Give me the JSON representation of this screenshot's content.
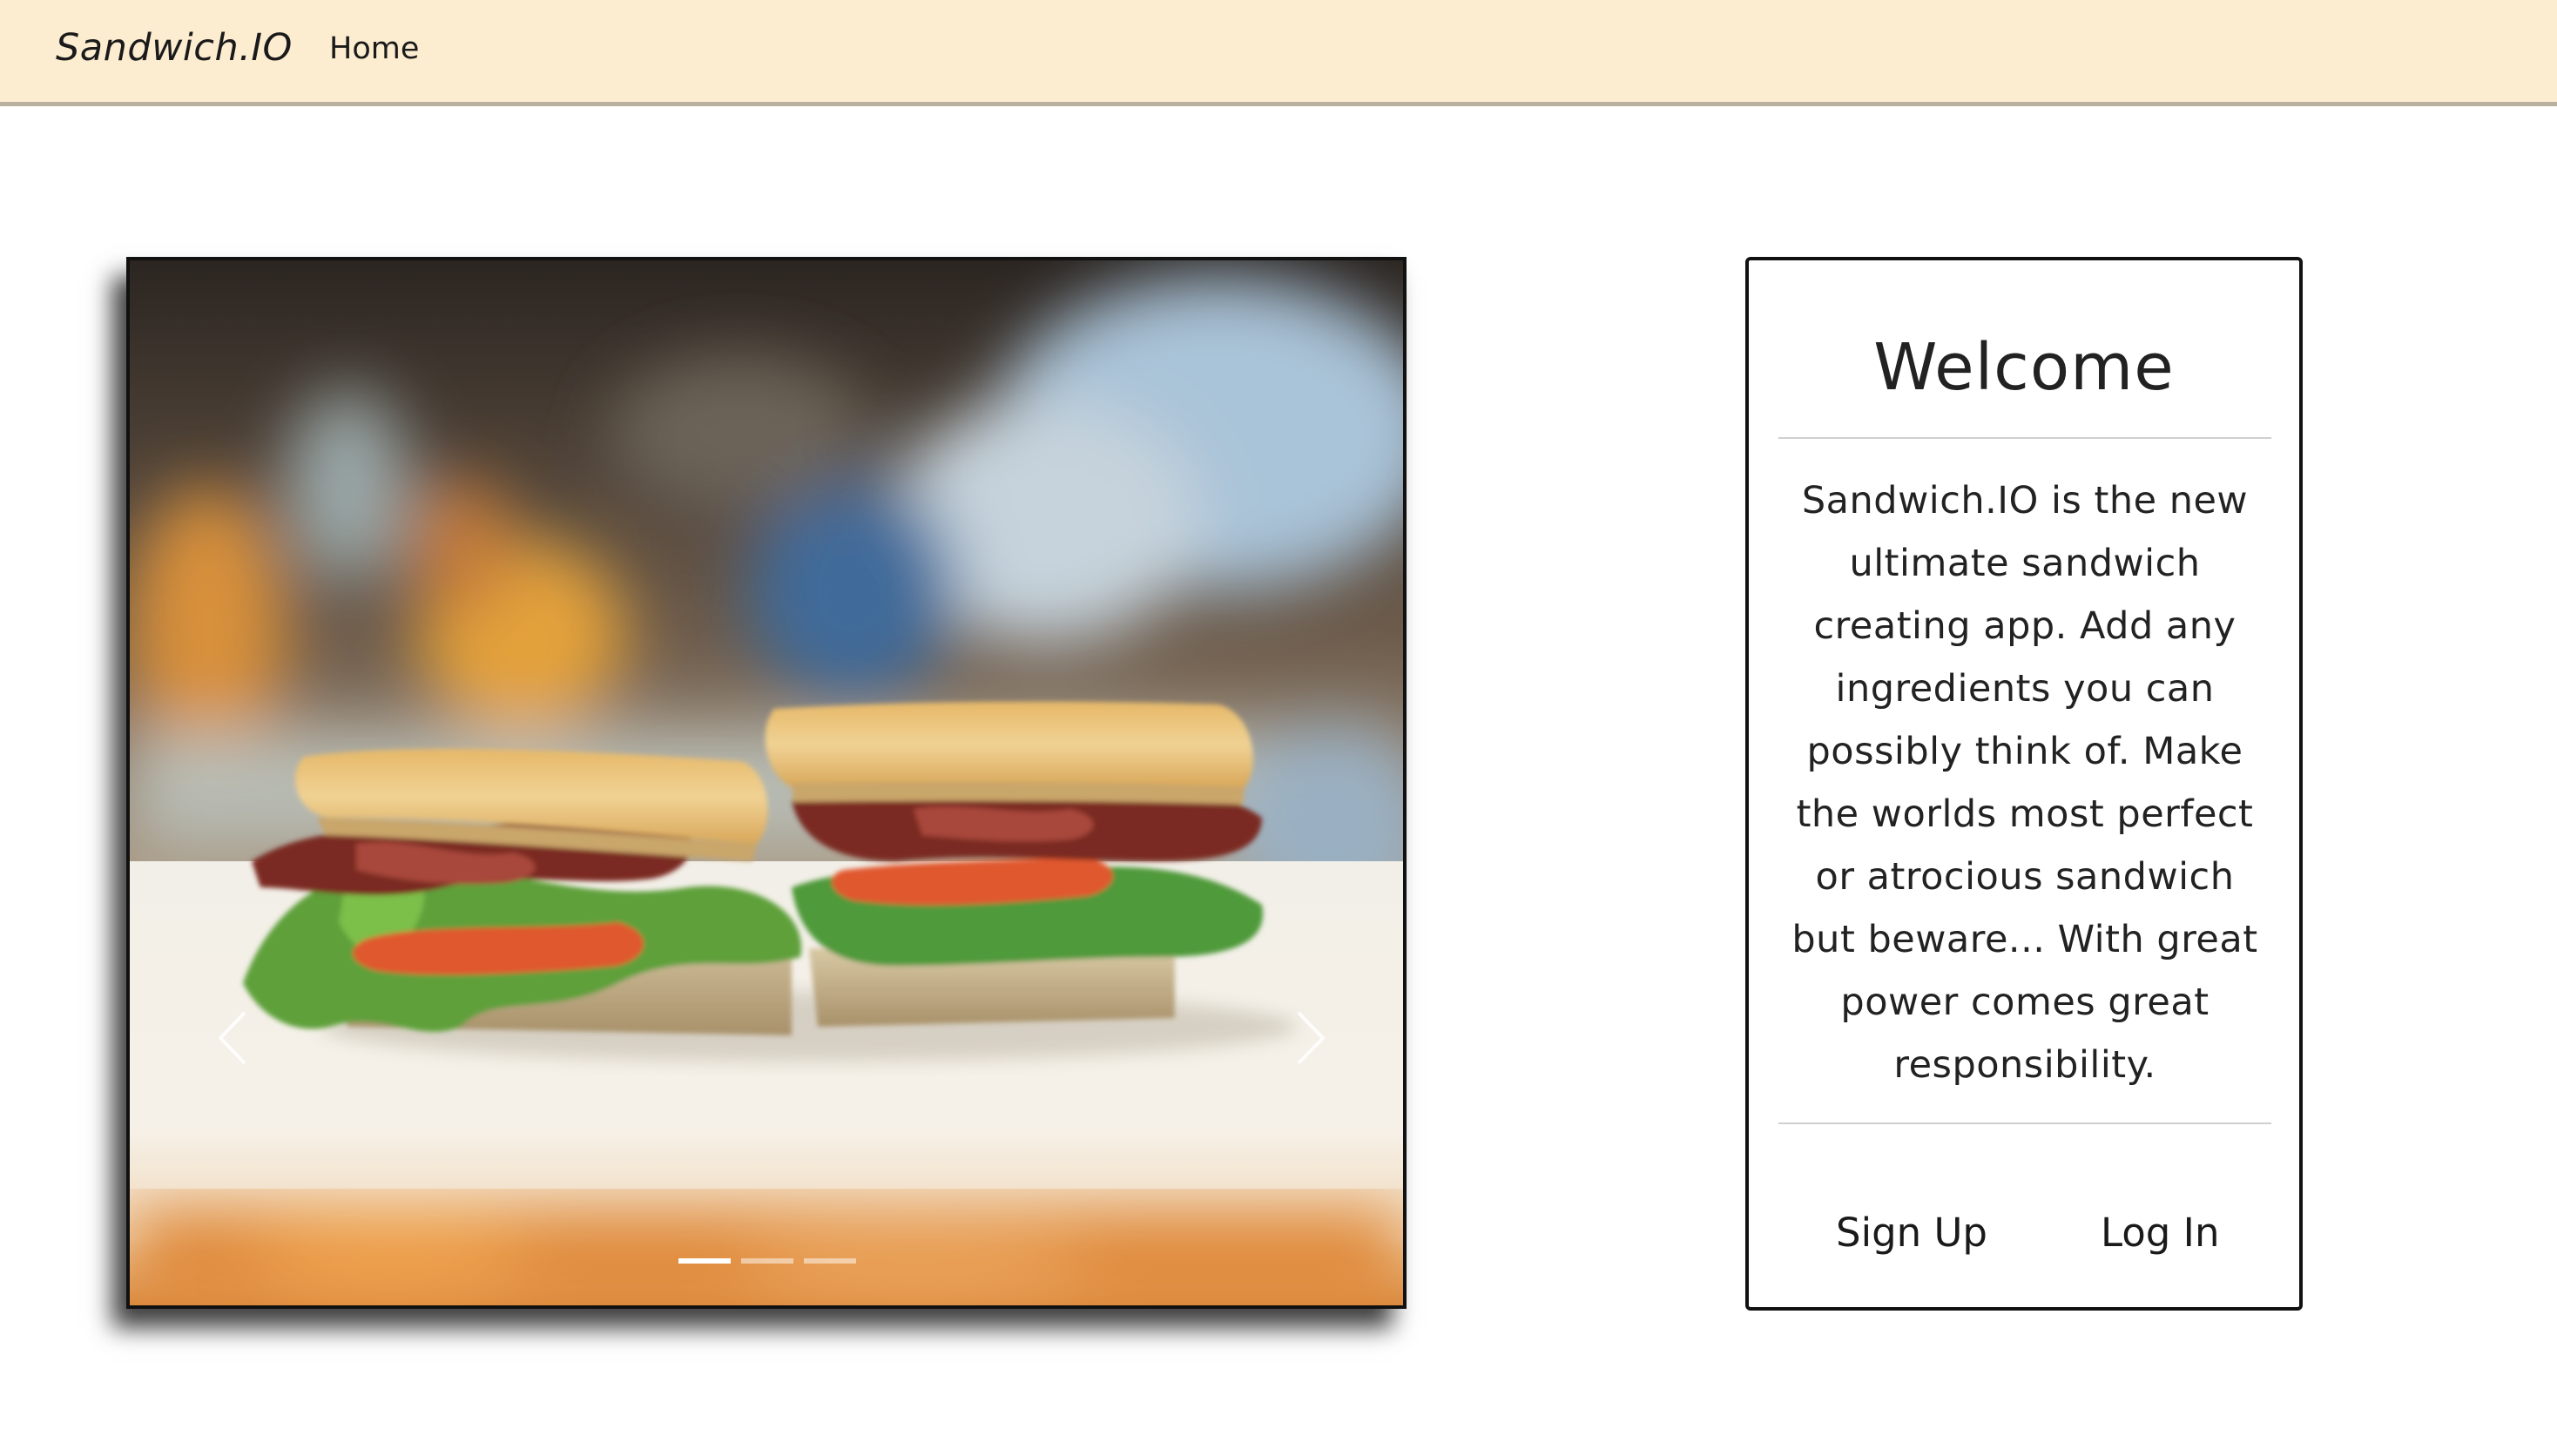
{
  "navbar": {
    "brand": "Sandwich.IO",
    "home_label": "Home"
  },
  "carousel": {
    "image_subject": "BLT sandwich halves",
    "prev_icon": "chevron-left-icon",
    "next_icon": "chevron-right-icon",
    "slide_count": 3,
    "active_slide": 1
  },
  "welcome": {
    "title": "Welcome",
    "body": "Sandwich.IO is the new ultimate sandwich creating app. Add any ingredients you can possibly think of. Make the worlds most perfect or atrocious sandwich but beware... With great power comes great responsibility.",
    "signup_label": "Sign Up",
    "login_label": "Log In"
  },
  "colors": {
    "navbar_bg": "#fcecd0",
    "navbar_border": "#b9b09f",
    "text": "#222222"
  }
}
